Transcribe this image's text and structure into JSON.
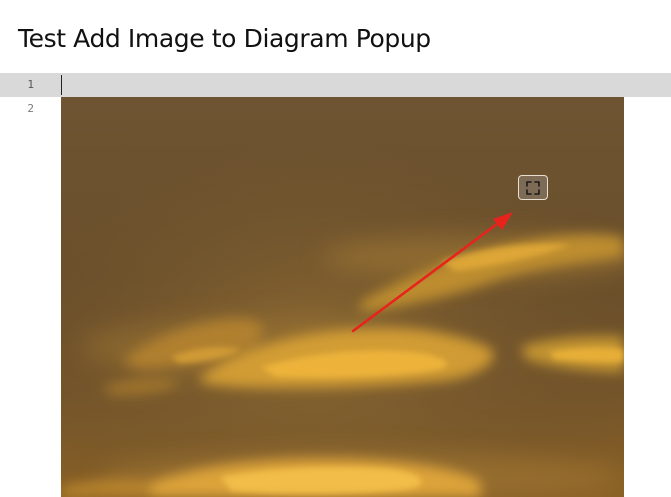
{
  "page": {
    "title": "Test Add Image to Diagram Popup"
  },
  "editor": {
    "line_numbers": [
      "1",
      "2"
    ]
  },
  "image": {
    "description": "sunset sky with orange clouds",
    "fullscreen_icon": "expand-icon"
  },
  "annotation": {
    "arrow_color": "#e8231c"
  }
}
